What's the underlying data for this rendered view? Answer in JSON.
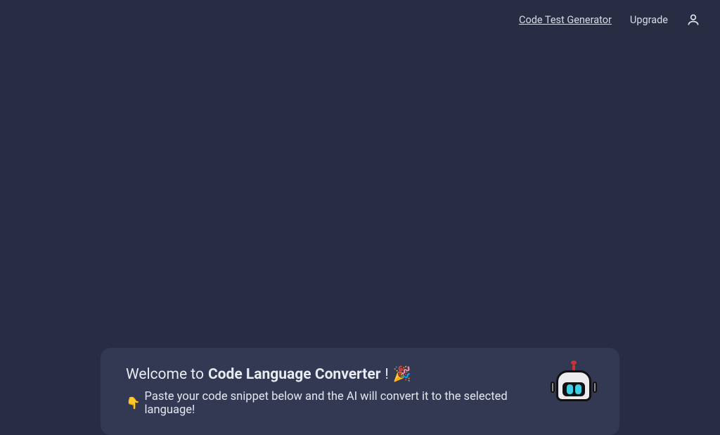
{
  "nav": {
    "link1": "Code Test Generator",
    "link2": "Upgrade"
  },
  "card": {
    "welcome_prefix": "Welcome to",
    "welcome_bold": "Code Language Converter",
    "welcome_suffix": "!",
    "party_emoji": "🎉",
    "point_emoji": "👇",
    "subtitle": "Paste your code snippet below and the AI will convert it to the selected language!"
  }
}
